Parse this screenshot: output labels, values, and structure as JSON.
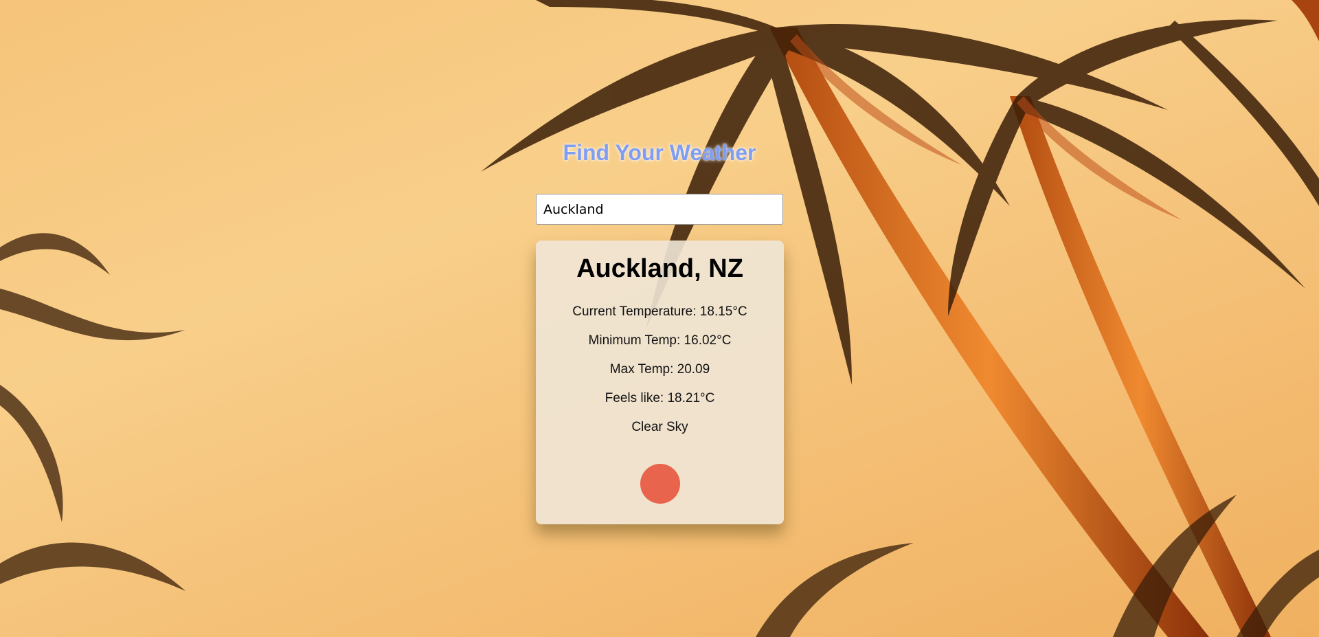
{
  "app": {
    "title": "Find Your Weather"
  },
  "search": {
    "value": "Auckland",
    "placeholder": ""
  },
  "weather": {
    "location": "Auckland, NZ",
    "current_temperature": "Current Temperature: 18.15°C",
    "minimum_temp": "Minimum Temp: 16.02°C",
    "max_temp": "Max Temp: 20.09",
    "feels_like": "Feels like: 18.21°C",
    "description": "Clear Sky",
    "icon": "sun-icon",
    "icon_color": "#e8644c"
  },
  "background": {
    "image": "palm-trees-sunset"
  }
}
